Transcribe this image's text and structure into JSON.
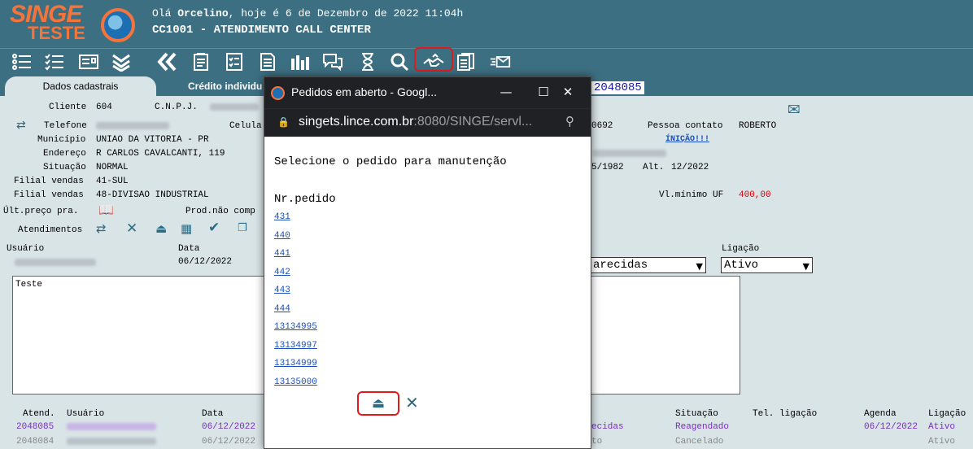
{
  "header": {
    "logo_text": "SINGE",
    "logo_sub": "TESTE",
    "greeting_prefix": "Olá",
    "user": "Orcelino",
    "greeting_suffix": ", hoje é 6 de Dezembro de 2022 11:04h",
    "title": "CC1001 - ATENDIMENTO CALL CENTER"
  },
  "toolbar": {
    "icons": [
      "list-icon",
      "checklist-icon",
      "card-icon",
      "chevrons-down-icon",
      "double-chevron-left-icon",
      "clipboard-icon",
      "checklist-doc-icon",
      "document-icon",
      "bar-chart-icon",
      "chat-icon",
      "hourglass-icon",
      "search-icon",
      "handshake-icon",
      "copy-doc-icon",
      "send-mail-icon"
    ]
  },
  "tabs": {
    "tab1": "Dados cadastrais",
    "tab2": "Crédito individu",
    "atendimento_number": "2048085"
  },
  "form": {
    "cliente_label": "Cliente",
    "cliente_value": "604",
    "cnpj_label": "C.N.P.J.",
    "telefone_label": "Telefone",
    "celular_label": "Celula",
    "municipio_label": "Município",
    "municipio_value": "UNIAO DA VITORIA - PR",
    "endereco_label": "Endereço",
    "endereco_value": "R CARLOS CAVALCANTI, 119",
    "situacao_label": "Situação",
    "situacao_value": "NORMAL",
    "filial1_label": "Filial vendas",
    "filial1_value": "41-SUL",
    "filial2_label": "Filial vendas",
    "filial2_value": "48-DIVISAO INDUSTRIAL",
    "ult_preco_label": "Últ.preço pra.",
    "prod_nao_comp_label": "Prod.não comp",
    "atendimentos_label": "Atendimentos",
    "right_num": "0692",
    "pessoa_contato_label": "Pessoa contato",
    "pessoa_contato_value": "ROBERTO",
    "inicio_link": "ÍNIÇÃO!!!",
    "date_partial": "5/1982",
    "alt_label": "Alt.",
    "alt_value": "12/2022",
    "vl_minimo_label": "Vl.mínimo UF",
    "vl_minimo_value": "400,00",
    "usuario_label": "Usuário",
    "data_label": "Data",
    "data_value": "06/12/2022",
    "ligacao_label": "Ligação",
    "select1_value": "arecidas",
    "select2_value": "Ativo",
    "notes_text": "Teste"
  },
  "grid": {
    "headers": {
      "atend": "Atend.",
      "usuario": "Usuário",
      "data": "Data",
      "situacao": "Situação",
      "tel_ligacao": "Tel. ligação",
      "agenda": "Agenda",
      "ligacao": "Ligação"
    },
    "rows": [
      {
        "atend": "2048085",
        "data": "06/12/2022",
        "col": "ecidas",
        "situacao": "Reagendado",
        "agenda": "06/12/2022",
        "ligacao": "Ativo"
      },
      {
        "atend": "2048084",
        "data": "06/12/2022",
        "col": "to",
        "situacao": "Cancelado",
        "agenda": "",
        "ligacao": "Ativo"
      }
    ]
  },
  "popup": {
    "window_title": "Pedidos em aberto - Googl...",
    "url_host": "singets.lince.com.br",
    "url_rest": ":8080/SINGE/servl...",
    "prompt": "Selecione o pedido para manutenção",
    "column_header": "Nr.pedido",
    "orders": [
      "431",
      "440",
      "441",
      "442",
      "443",
      "444",
      "13134995",
      "13134997",
      "13134999",
      "13135000"
    ]
  }
}
